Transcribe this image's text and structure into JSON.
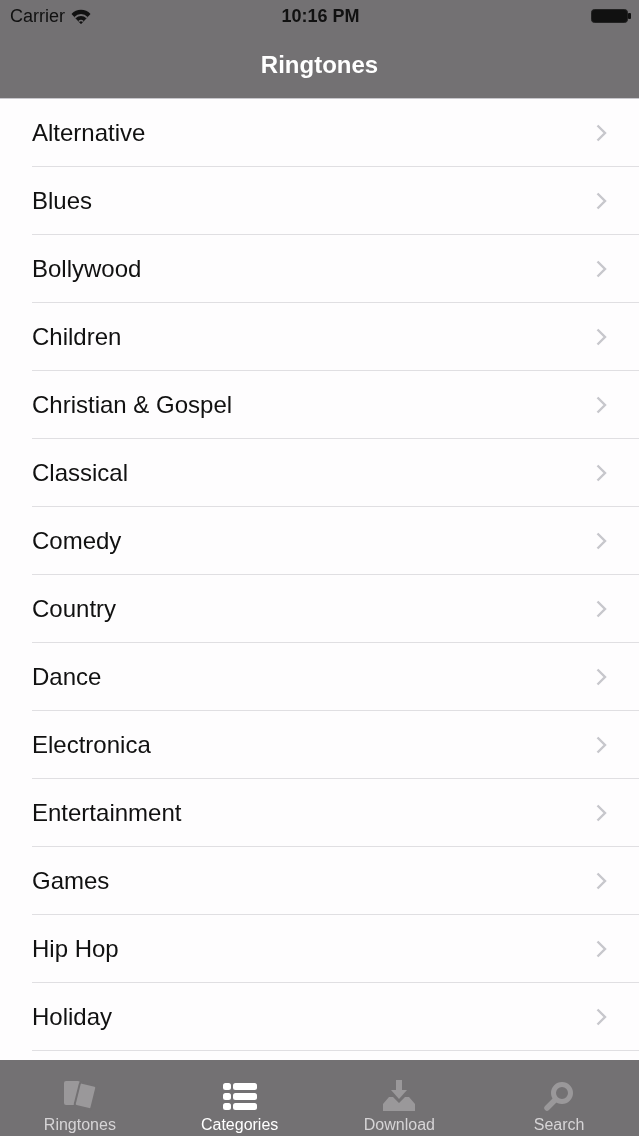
{
  "status_bar": {
    "carrier": "Carrier",
    "time": "10:16 PM"
  },
  "nav_bar": {
    "title": "Ringtones"
  },
  "categories": [
    "Alternative",
    "Blues",
    "Bollywood",
    "Children",
    "Christian & Gospel",
    "Classical",
    "Comedy",
    "Country",
    "Dance",
    "Electronica",
    "Entertainment",
    "Games",
    "Hip Hop",
    "Holiday"
  ],
  "tab_bar": [
    {
      "label": "Ringtones",
      "selected": false
    },
    {
      "label": "Categories",
      "selected": true
    },
    {
      "label": "Download",
      "selected": false
    },
    {
      "label": "Search",
      "selected": false
    }
  ]
}
